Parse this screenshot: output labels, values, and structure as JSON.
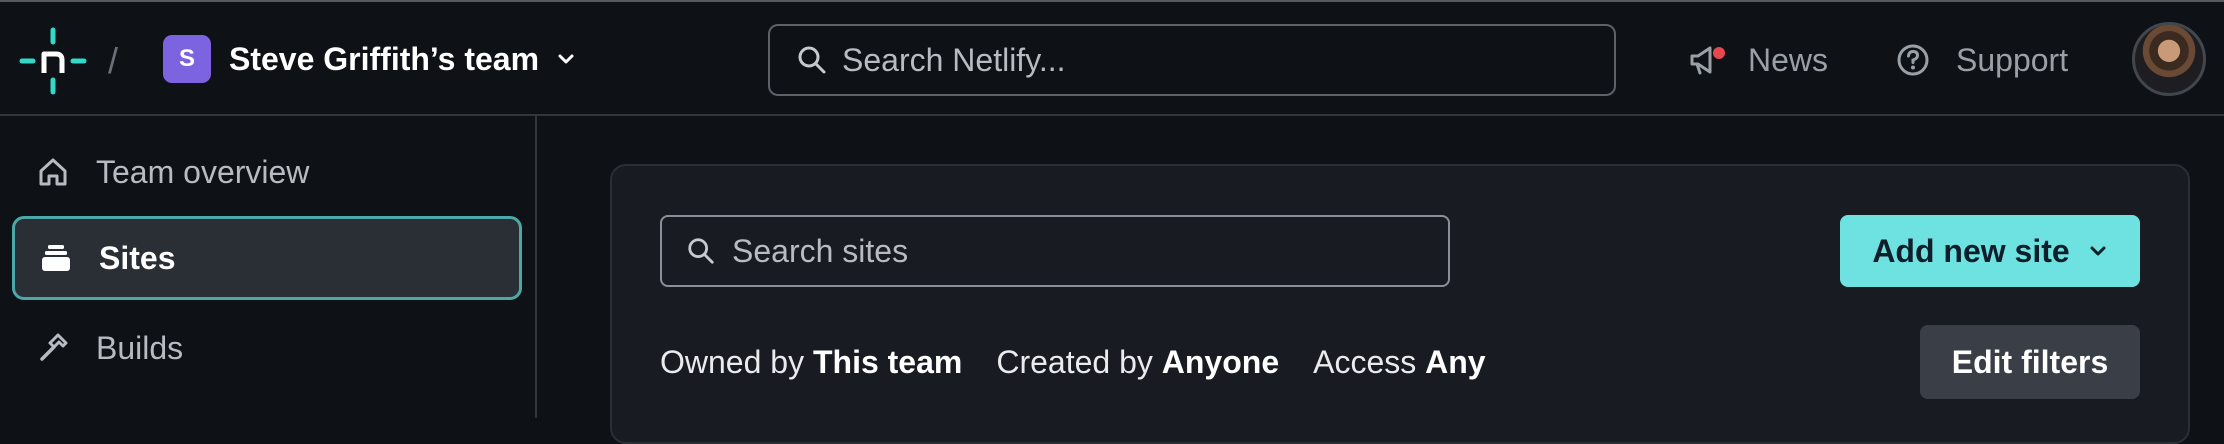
{
  "header": {
    "breadcrumb_separator": "/",
    "team": {
      "avatar_letter": "S",
      "name": "Steve Griffith’s team"
    },
    "search": {
      "placeholder": "Search Netlify..."
    },
    "news_label": "News",
    "support_label": "Support"
  },
  "sidebar": {
    "items": [
      {
        "label": "Team overview",
        "icon": "home-icon",
        "active": false
      },
      {
        "label": "Sites",
        "icon": "sites-stack-icon",
        "active": true
      },
      {
        "label": "Builds",
        "icon": "hammer-icon",
        "active": false
      }
    ]
  },
  "main": {
    "site_search": {
      "placeholder": "Search sites"
    },
    "add_site_label": "Add new site",
    "filters": [
      {
        "label": "Owned by",
        "value": "This team"
      },
      {
        "label": "Created by",
        "value": "Anyone"
      },
      {
        "label": "Access",
        "value": "Any"
      }
    ],
    "edit_filters_label": "Edit filters"
  },
  "colors": {
    "background": "#0e1116",
    "accent_teal": "#6ee2e0",
    "team_avatar": "#7c63e0",
    "notification_dot": "#e5484d"
  }
}
